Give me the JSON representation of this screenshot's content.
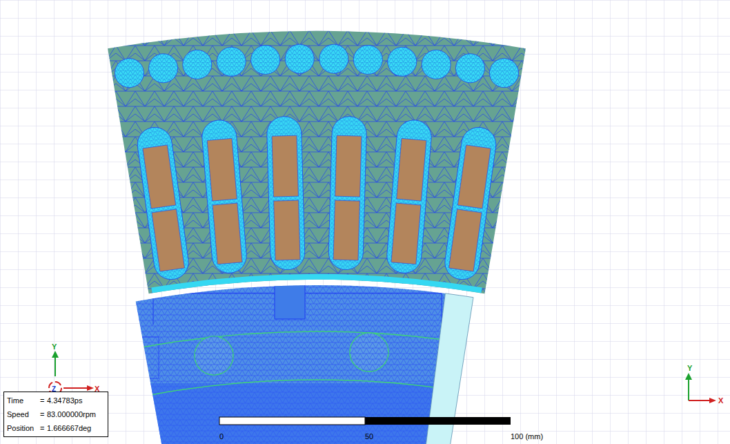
{
  "plot": {
    "kind": "mesh-view"
  },
  "annotation": {
    "separator": "=",
    "rows": [
      {
        "label": "Time",
        "value": "4.34783ps"
      },
      {
        "label": "Speed",
        "value": "83.000000rpm"
      },
      {
        "label": "Position",
        "value": "1.666667deg"
      }
    ]
  },
  "scale_bar": {
    "ticks": [
      "0",
      "50",
      "100 (mm)"
    ]
  },
  "triads": [
    {
      "labels": [
        "Y",
        "Z",
        "X"
      ]
    },
    {
      "labels": [
        "Y",
        "X"
      ]
    }
  ]
}
